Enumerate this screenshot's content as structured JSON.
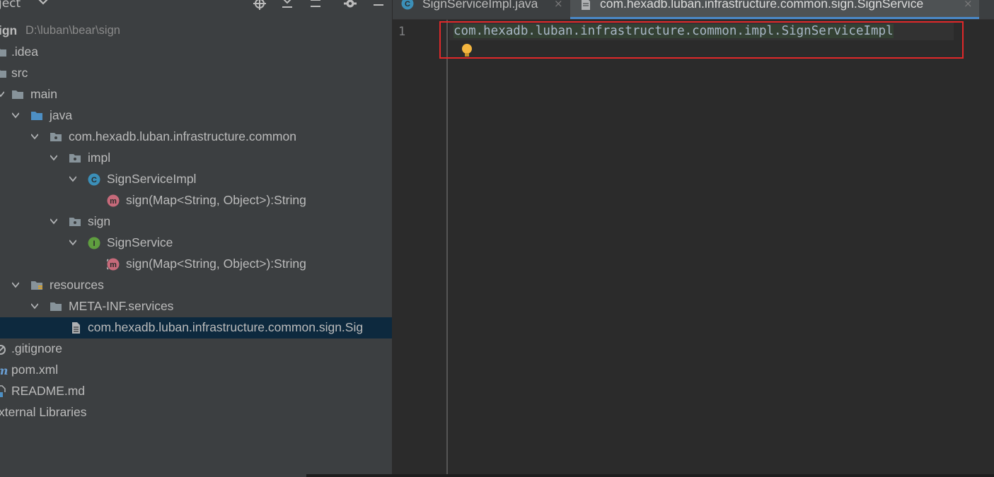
{
  "project_toolbar": {
    "title": "ject"
  },
  "tree": [
    {
      "label": "ign",
      "hint": "D:\\luban\\bear\\sign",
      "kind": "module"
    },
    {
      "label": ".idea",
      "kind": "folder"
    },
    {
      "label": "src",
      "kind": "folder"
    },
    {
      "label": "main",
      "kind": "folder"
    },
    {
      "label": "java",
      "kind": "source-folder"
    },
    {
      "label": "com.hexadb.luban.infrastructure.common",
      "kind": "package"
    },
    {
      "label": "impl",
      "kind": "package"
    },
    {
      "label": "SignServiceImpl",
      "kind": "class",
      "badge": "C"
    },
    {
      "label": "sign(Map<String, Object>):String",
      "kind": "method",
      "badge": "m"
    },
    {
      "label": "sign",
      "kind": "package"
    },
    {
      "label": "SignService",
      "kind": "interface",
      "badge": "I"
    },
    {
      "label": "sign(Map<String, Object>):String",
      "kind": "method",
      "badge": "m"
    },
    {
      "label": "resources",
      "kind": "resources-folder"
    },
    {
      "label": "META-INF.services",
      "kind": "folder"
    },
    {
      "label": "com.hexadb.luban.infrastructure.common.sign.Sig",
      "kind": "file",
      "selected": true
    },
    {
      "label": ".gitignore",
      "kind": "file"
    },
    {
      "label": "pom.xml",
      "kind": "file"
    },
    {
      "label": "README.md",
      "kind": "file"
    },
    {
      "label": "xternal Libraries",
      "kind": "libraries"
    }
  ],
  "tabs": [
    {
      "label": "SignServiceImpl.java",
      "close": "×",
      "active": false
    },
    {
      "label": "com.hexadb.luban.infrastructure.common.sign.SignService",
      "close": "×",
      "active": true
    }
  ],
  "editor": {
    "line_number": "1",
    "code": "com.hexadb.luban.infrastructure.common.impl.SignServiceImpl"
  },
  "colors": {
    "accent": "#4a88c7",
    "selection": "#0d293e",
    "highlight_box": "#e0282a",
    "bulb": "#f4b63f",
    "class_badge": "#3b8fb8",
    "interface_badge": "#5f9e3f",
    "method_badge": "#c66a7a"
  },
  "icons": {
    "toolbar": [
      "chevron-down-icon",
      "target-icon",
      "collapse-all-icon",
      "expand-all-icon",
      "gear-icon",
      "minimize-icon"
    ],
    "editor": [
      "lightbulb-icon"
    ]
  }
}
